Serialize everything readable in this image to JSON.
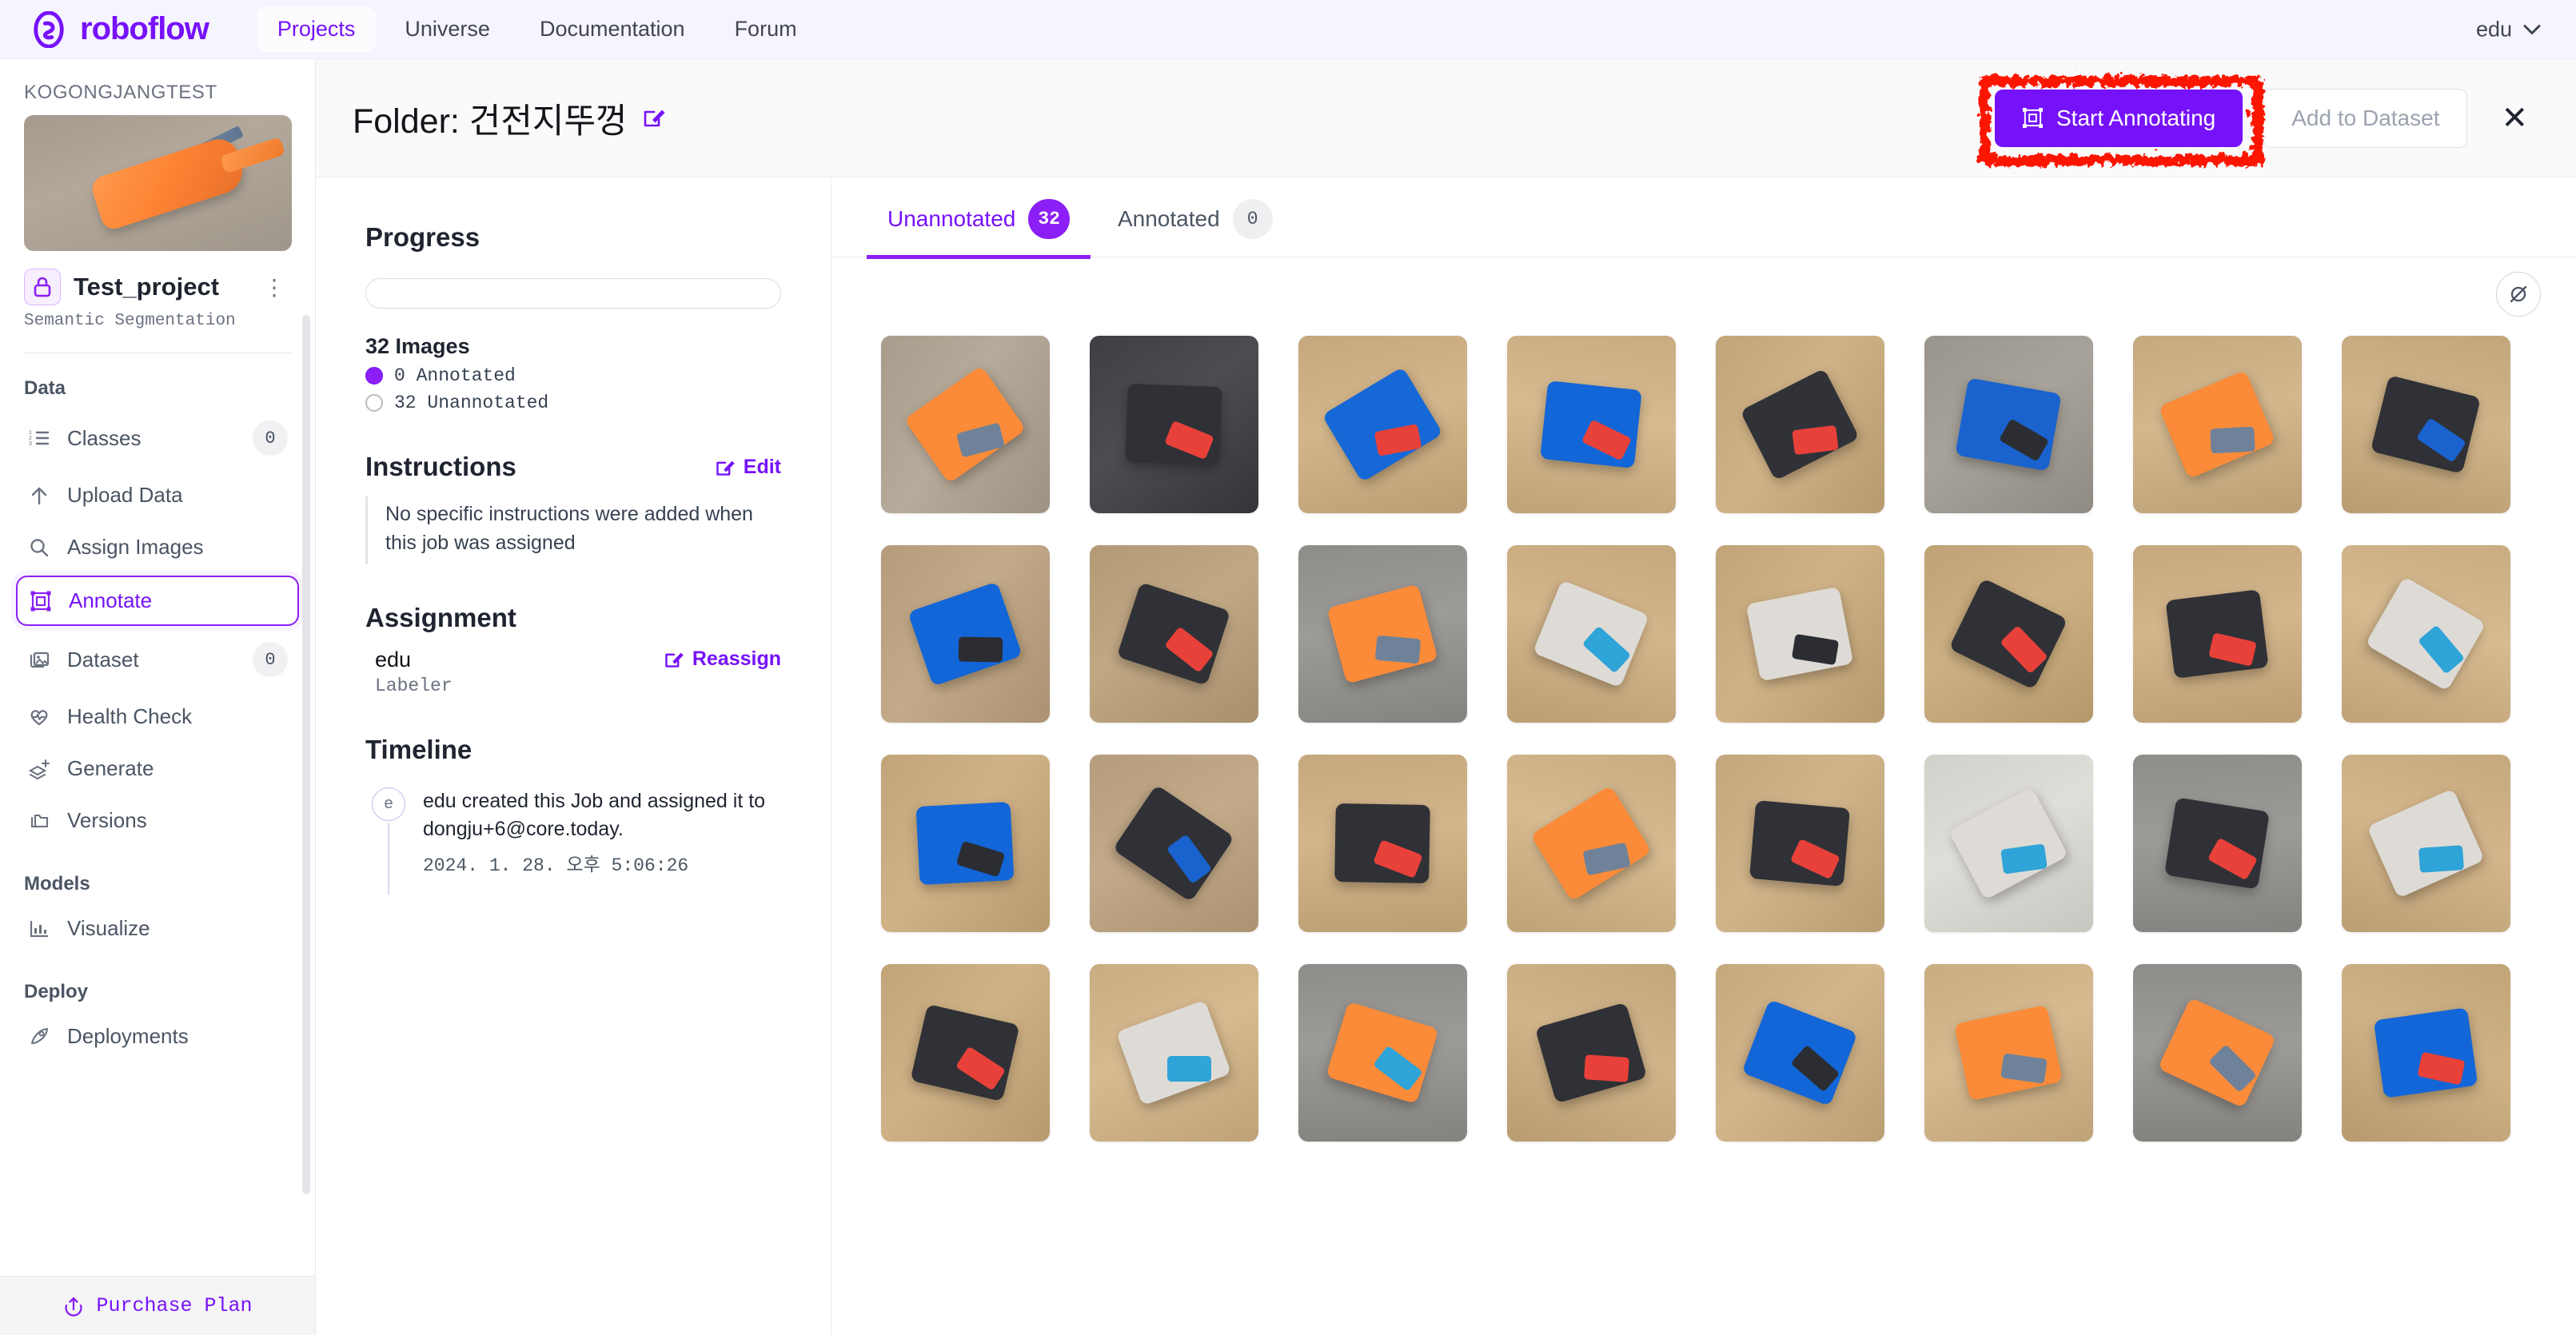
{
  "topnav": {
    "brand": "roboflow",
    "links": [
      {
        "label": "Projects",
        "active": true
      },
      {
        "label": "Universe",
        "active": false
      },
      {
        "label": "Documentation",
        "active": false
      },
      {
        "label": "Forum",
        "active": false
      }
    ],
    "user": "edu",
    "user_chevron_icon": "chevron-down-icon"
  },
  "sidebar": {
    "workspace": "KOGONGJANGTEST",
    "project_name": "Test_project",
    "project_type": "Semantic Segmentation",
    "project_lock_icon": "lock-icon",
    "project_menu_icon": "kebab-menu-icon",
    "sections": [
      {
        "title": "Data",
        "items": [
          {
            "label": "Classes",
            "icon": "ordered-list-icon",
            "badge": "0",
            "active": false
          },
          {
            "label": "Upload Data",
            "icon": "upload-arrow-icon",
            "badge": "",
            "active": false
          },
          {
            "label": "Assign Images",
            "icon": "search-icon",
            "badge": "",
            "active": false
          },
          {
            "label": "Annotate",
            "icon": "annotate-box-icon",
            "badge": "",
            "active": true
          },
          {
            "label": "Dataset",
            "icon": "images-stack-icon",
            "badge": "0",
            "active": false
          },
          {
            "label": "Health Check",
            "icon": "heartbeat-icon",
            "badge": "",
            "active": false
          },
          {
            "label": "Generate",
            "icon": "layers-plus-icon",
            "badge": "",
            "active": false
          },
          {
            "label": "Versions",
            "icon": "folders-icon",
            "badge": "",
            "active": false
          }
        ]
      },
      {
        "title": "Models",
        "items": [
          {
            "label": "Visualize",
            "icon": "bar-chart-icon",
            "badge": "",
            "active": false
          }
        ]
      },
      {
        "title": "Deploy",
        "items": [
          {
            "label": "Deployments",
            "icon": "rocket-icon",
            "badge": "",
            "active": false
          }
        ]
      }
    ],
    "footer": {
      "label": "Purchase Plan",
      "icon": "upload-circle-icon"
    }
  },
  "header": {
    "title": "Folder: 건전지뚜껑",
    "title_edit_icon": "edit-pencil-icon",
    "start_annotating_label": "Start Annotating",
    "start_annotating_icon": "annotate-box-icon",
    "add_to_dataset_label": "Add to Dataset",
    "close_icon": "close-x-icon",
    "highlight_color": "#fc1905",
    "accent_color": "#7612fa"
  },
  "info": {
    "progress_heading": "Progress",
    "progress_percent": 0,
    "image_count_label": "32 Images",
    "legend": [
      {
        "label": "0 Annotated",
        "state": "filled"
      },
      {
        "label": "32 Unannotated",
        "state": "hollow"
      }
    ],
    "instructions_heading": "Instructions",
    "instructions_edit_label": "Edit",
    "instructions_edit_icon": "edit-pencil-icon",
    "instructions_text": "No specific instructions were added when this job was assigned",
    "assignment_heading": "Assignment",
    "assignee_name": "edu",
    "assignee_role": "Labeler",
    "reassign_label": "Reassign",
    "reassign_icon": "edit-pencil-icon",
    "timeline_heading": "Timeline",
    "timeline_items": [
      {
        "avatar": "e",
        "text": "edu created this Job and assigned it to dongju+6@core.today.",
        "date": "2024. 1. 28. 오후 5:06:26"
      }
    ]
  },
  "grid": {
    "tabs": [
      {
        "label": "Unannotated",
        "count": "32",
        "active": true
      },
      {
        "label": "Annotated",
        "count": "0",
        "active": false
      }
    ],
    "tool_icon": "no-annotation-icon",
    "thumbnails": [
      {
        "id": 1,
        "subject": "orange-drill-on-carpet",
        "bg": "#a89c8c",
        "obj": "#fb8b38",
        "obj2": "#6f829a"
      },
      {
        "id": 2,
        "subject": "black-truck-chassis-underside",
        "bg": "#3d3f44",
        "obj": "#2f3136",
        "obj2": "#e8413a"
      },
      {
        "id": 3,
        "subject": "blue-truck-top-view",
        "bg": "#c6a87e",
        "obj": "#1668d6",
        "obj2": "#e8413a"
      },
      {
        "id": 4,
        "subject": "blue-truck-angled",
        "bg": "#c9ac82",
        "obj": "#1266d8",
        "obj2": "#e8413a"
      },
      {
        "id": 5,
        "subject": "black-car-underside-wood",
        "bg": "#c2a479",
        "obj": "#303238",
        "obj2": "#e8413a"
      },
      {
        "id": 6,
        "subject": "blue-bus-front-carpet",
        "bg": "#9a958c",
        "obj": "#1a63cf",
        "obj2": "#2b2d33"
      },
      {
        "id": 7,
        "subject": "orange-drill-wood",
        "bg": "#c5a97f",
        "obj": "#fb8b38",
        "obj2": "#6f829a"
      },
      {
        "id": 8,
        "subject": "black-blue-truck-underside",
        "bg": "#c3a67c",
        "obj": "#2f3136",
        "obj2": "#1a63cf"
      },
      {
        "id": 9,
        "subject": "blue-dump-truck-top",
        "bg": "#b59c7b",
        "obj": "#1266d8",
        "obj2": "#2b2d33"
      },
      {
        "id": 10,
        "subject": "black-chassis-blue-red-wire",
        "bg": "#b39a77",
        "obj": "#2f3136",
        "obj2": "#e8413a"
      },
      {
        "id": 11,
        "subject": "orange-drill-gray-carpet",
        "bg": "#8f8d8a",
        "obj": "#fb8b38",
        "obj2": "#6f829a"
      },
      {
        "id": 12,
        "subject": "white-plane-top-view",
        "bg": "#c6a87e",
        "obj": "#dedbd6",
        "obj2": "#2fa4d8"
      },
      {
        "id": 13,
        "subject": "white-plane-underside",
        "bg": "#c2a479",
        "obj": "#dedbd6",
        "obj2": "#2b2d33"
      },
      {
        "id": 14,
        "subject": "black-chassis-red-wire",
        "bg": "#bfa275",
        "obj": "#2f3136",
        "obj2": "#e8413a"
      },
      {
        "id": 15,
        "subject": "black-car-with-wheels",
        "bg": "#c6a87e",
        "obj": "#2f3136",
        "obj2": "#e8413a"
      },
      {
        "id": 16,
        "subject": "white-plane-blue-wing",
        "bg": "#c9ac82",
        "obj": "#dedbd6",
        "obj2": "#2fa4d8"
      },
      {
        "id": 17,
        "subject": "blue-bus-tayo",
        "bg": "#c2a479",
        "obj": "#1266d8",
        "obj2": "#2b2d33"
      },
      {
        "id": 18,
        "subject": "black-chassis-blue-body",
        "bg": "#b59c7b",
        "obj": "#2f3136",
        "obj2": "#1a63cf"
      },
      {
        "id": 19,
        "subject": "black-truck-top-red",
        "bg": "#c6a87e",
        "obj": "#2f3136",
        "obj2": "#e8413a"
      },
      {
        "id": 20,
        "subject": "orange-drill-wood-2",
        "bg": "#c9ac82",
        "obj": "#fb8b38",
        "obj2": "#6f829a"
      },
      {
        "id": 21,
        "subject": "black-chassis-wheels-red",
        "bg": "#c3a67c",
        "obj": "#2f3136",
        "obj2": "#e8413a"
      },
      {
        "id": 22,
        "subject": "white-plane-angled",
        "bg": "#d2d0cb",
        "obj": "#dedbd6",
        "obj2": "#2fa4d8"
      },
      {
        "id": 23,
        "subject": "black-chassis-gray-carpet",
        "bg": "#8f8d8a",
        "obj": "#2f3136",
        "obj2": "#e8413a"
      },
      {
        "id": 24,
        "subject": "white-plane-blue-tail",
        "bg": "#c6a87e",
        "obj": "#dedbd6",
        "obj2": "#2fa4d8"
      },
      {
        "id": 25,
        "subject": "black-truck-red-base",
        "bg": "#c2a479",
        "obj": "#2f3136",
        "obj2": "#e8413a"
      },
      {
        "id": 26,
        "subject": "white-plane-wheels",
        "bg": "#c9ac82",
        "obj": "#dedbd6",
        "obj2": "#2fa4d8"
      },
      {
        "id": 27,
        "subject": "orange-drill-gray-carpet-2",
        "bg": "#8f8d8a",
        "obj": "#fb8b38",
        "obj2": "#2fa4d8"
      },
      {
        "id": 28,
        "subject": "black-chassis-red-car",
        "bg": "#c3a67c",
        "obj": "#2f3136",
        "obj2": "#e8413a"
      },
      {
        "id": 29,
        "subject": "blue-dump-truck-open",
        "bg": "#c6a87e",
        "obj": "#1266d8",
        "obj2": "#2b2d33"
      },
      {
        "id": 30,
        "subject": "orange-drill-wood-3",
        "bg": "#c9ac82",
        "obj": "#fb8b38",
        "obj2": "#6f829a"
      },
      {
        "id": 31,
        "subject": "orange-drill-gray-carpet-3",
        "bg": "#8f8d8a",
        "obj": "#fb8b38",
        "obj2": "#6f829a"
      },
      {
        "id": 32,
        "subject": "blue-truck-top-wood",
        "bg": "#c2a479",
        "obj": "#1266d8",
        "obj2": "#e8413a"
      }
    ]
  }
}
